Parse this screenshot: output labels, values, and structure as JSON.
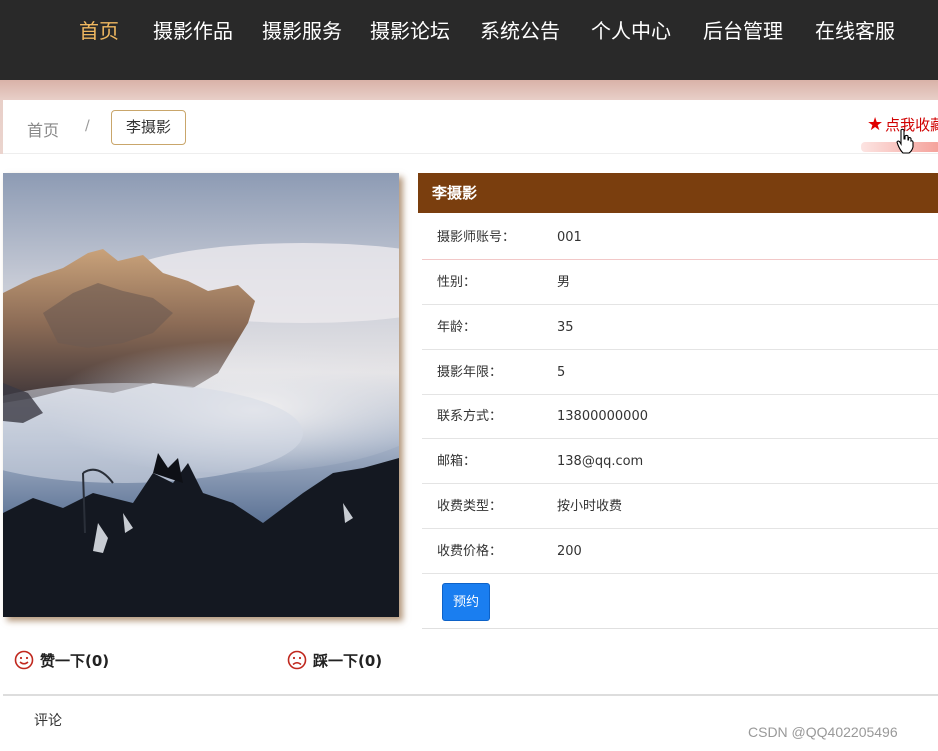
{
  "nav": {
    "items": [
      "首页",
      "摄影作品",
      "摄影服务",
      "摄影论坛",
      "系统公告",
      "个人中心",
      "后台管理",
      "在线客服"
    ],
    "active_index": 0
  },
  "breadcrumb": {
    "home": "首页",
    "separator": "/",
    "current": "李摄影"
  },
  "favorite": {
    "label": "点我收藏",
    "icon": "star-icon"
  },
  "detail": {
    "title": "李摄影",
    "rows": [
      {
        "label": "摄影师账号：",
        "value": "001"
      },
      {
        "label": "性别：",
        "value": "男"
      },
      {
        "label": "年龄：",
        "value": "35"
      },
      {
        "label": "摄影年限：",
        "value": "5"
      },
      {
        "label": "联系方式：",
        "value": "13800000000"
      },
      {
        "label": "邮箱：",
        "value": "138@qq.com"
      },
      {
        "label": "收费类型：",
        "value": "按小时收费"
      },
      {
        "label": "收费价格：",
        "value": "200"
      }
    ],
    "book_label": "预约"
  },
  "votes": {
    "like": "赞一下(0)",
    "dislike": "踩一下(0)"
  },
  "comments": {
    "title": "评论"
  },
  "watermark": "CSDN @QQ402205496",
  "colors": {
    "nav_bg": "#292929",
    "nav_active": "#f0b860",
    "header_bg": "#7a3e0e",
    "button_bg": "#1a7ef0",
    "favorite": "#d00000"
  }
}
